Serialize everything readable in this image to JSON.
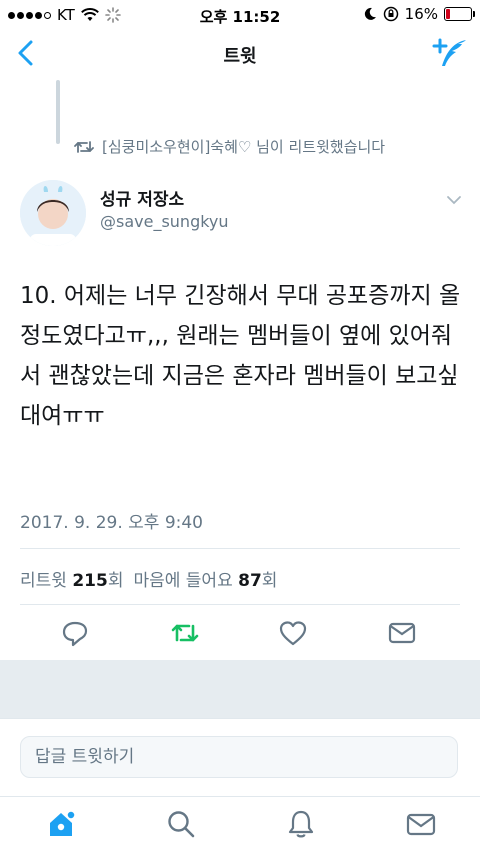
{
  "status_bar": {
    "carrier": "KT",
    "time": "오후 11:52",
    "battery_text": "16%",
    "battery_level": 0.16
  },
  "nav": {
    "title": "트윗"
  },
  "retweet_context": {
    "text": "[심쿵미소우현이]숙혜♡ 님이 리트윗했습니다"
  },
  "author": {
    "name": "성규 저장소",
    "handle": "@save_sungkyu"
  },
  "tweet": {
    "text": "10. 어제는 너무 긴장해서 무대 공포증까지 올 정도였다고ㅠ,,, 원래는 멤버들이 옆에 있어줘서 괜찮았는데 지금은 혼자라 멤버들이 보고싶대여ㅠㅠ",
    "timestamp": "2017. 9. 29. 오후 9:40"
  },
  "stats": {
    "retweet_label": "리트윗",
    "retweet_count": "215",
    "retweet_unit": "회",
    "like_label": "마음에 들어요",
    "like_count": "87",
    "like_unit": "회"
  },
  "reply": {
    "placeholder": "답글 트윗하기"
  },
  "colors": {
    "accent": "#1da1f2",
    "retweet_green": "#17bf63",
    "secondary_text": "#657786",
    "icon_gray": "#657786"
  },
  "icons": {
    "back": "chevron-left-icon",
    "compose": "compose-tweet-icon",
    "reply": "reply-icon",
    "retweet": "retweet-icon",
    "like": "heart-icon",
    "dm": "direct-message-icon",
    "home": "home-icon",
    "search": "search-icon",
    "notifications": "bell-icon",
    "messages": "envelope-icon"
  }
}
